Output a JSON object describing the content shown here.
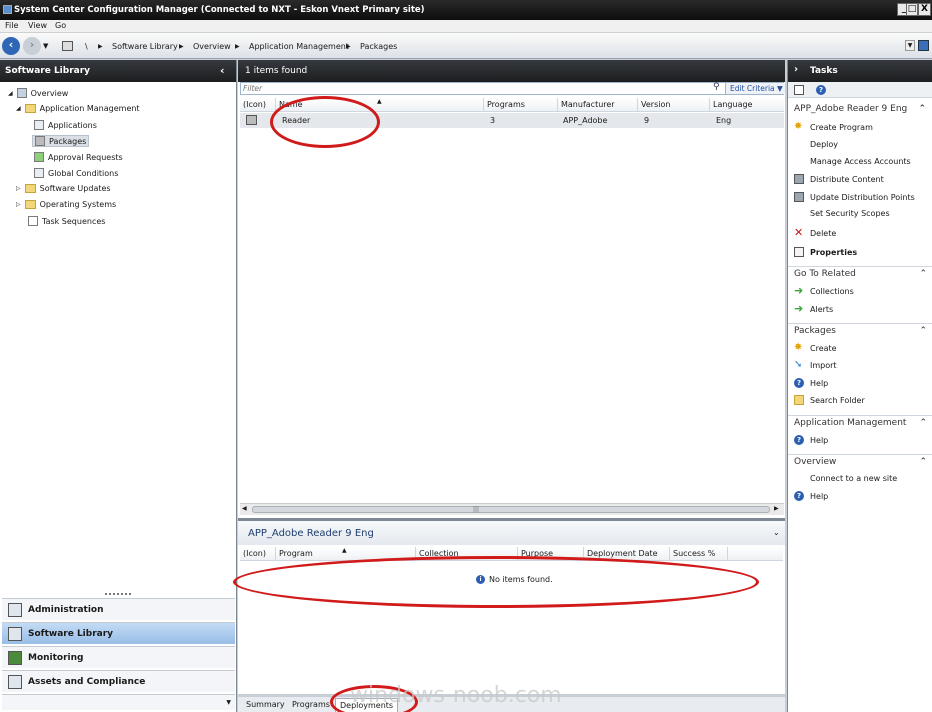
{
  "window": {
    "title": "System Center Configuration Manager (Connected to NXT - Eskon Vnext Primary site)",
    "min": "_",
    "max": "□",
    "close": "X"
  },
  "menu": [
    "File",
    "View",
    "Go"
  ],
  "breadcrumb": [
    "\\",
    "Software Library",
    "Overview",
    "Application Management",
    "Packages"
  ],
  "left_pane": {
    "title": "Software Library",
    "tree": [
      "Overview",
      "Application Management",
      "Applications",
      "Packages",
      "Approval Requests",
      "Global Conditions",
      "Software Updates",
      "Operating Systems",
      "Task Sequences"
    ],
    "workspaces": [
      "Administration",
      "Software Library",
      "Monitoring",
      "Assets and Compliance"
    ]
  },
  "main": {
    "status": "1 items found",
    "filter_placeholder": "Filter",
    "edit_criteria": "Edit Criteria",
    "columns": [
      "(Icon)",
      "Name",
      "Programs",
      "Manufacturer",
      "Version",
      "Language"
    ],
    "rows": [
      {
        "name": "Reader",
        "programs": "3",
        "manufacturer": "APP_Adobe",
        "version": "9",
        "language": "Eng"
      }
    ]
  },
  "details": {
    "title": "APP_Adobe Reader 9 Eng",
    "columns": [
      "(Icon)",
      "Program",
      "Collection",
      "Purpose",
      "Deployment Date",
      "Success %"
    ],
    "empty_message": "No items found.",
    "tabs": [
      "Summary",
      "Programs",
      "Deployments"
    ]
  },
  "tasks": {
    "title": "Tasks",
    "selected_title": "APP_Adobe Reader 9 Eng",
    "actions": [
      "Create Program",
      "Deploy",
      "Manage Access Accounts",
      "Distribute Content",
      "Update Distribution Points",
      "Set Security Scopes",
      "Delete",
      "Properties"
    ],
    "go_to_related": {
      "title": "Go To Related",
      "items": [
        "Collections",
        "Alerts"
      ]
    },
    "packages": {
      "title": "Packages",
      "items": [
        "Create",
        "Import",
        "Help",
        "Search Folder"
      ]
    },
    "app_mgmt": {
      "title": "Application Management",
      "items": [
        "Help"
      ]
    },
    "overview": {
      "title": "Overview",
      "items": [
        "Connect to a new site",
        "Help"
      ]
    }
  },
  "watermark": "windows-noob.com",
  "colors": {
    "annotation": "#d11a1a",
    "selected_workspace": "#a9c8ec",
    "link_blue": "#1f4e9e"
  }
}
